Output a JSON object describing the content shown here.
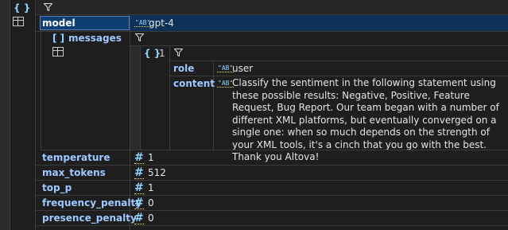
{
  "root_badge": "{ }",
  "fields": [
    {
      "key": "model",
      "type": "string",
      "type_badge": "\"AB\"",
      "value": "gpt-4"
    },
    {
      "key": "temperature",
      "type": "number",
      "type_badge": "#",
      "value": "1"
    },
    {
      "key": "max_tokens",
      "type": "number",
      "type_badge": "#",
      "value": "512"
    },
    {
      "key": "top_p",
      "type": "number",
      "type_badge": "#",
      "value": "1"
    },
    {
      "key": "frequency_penalty",
      "type": "number",
      "type_badge": "#",
      "value": "0"
    },
    {
      "key": "presence_penalty",
      "type": "number",
      "type_badge": "#",
      "value": "0"
    }
  ],
  "messages": {
    "badge": "[ ]",
    "key": "messages",
    "items": [
      {
        "badge": "{ }",
        "index": "1",
        "rows": [
          {
            "key": "role",
            "type_badge": "\"AB\"",
            "value": "user"
          },
          {
            "key": "content",
            "type_badge": "\"AB\"",
            "value": "Classify the sentiment in the following statement using these possible results: Negative, Positive, Feature Request, Bug Report. Our team began with a number of different XML platforms, but eventually converged on a single one: when so much depends on the strength of your XML tools, it's a cinch that you go with the best. Thank you Altova!"
          }
        ]
      }
    ]
  },
  "icons": {
    "filter": "funnel-filter-icon",
    "table": "grid-table-icon"
  },
  "colors": {
    "background": "#1e1e1e",
    "key_text": "#9ec8ff",
    "selection": "#0e3f72",
    "type_badge": "#8fd6ff"
  }
}
